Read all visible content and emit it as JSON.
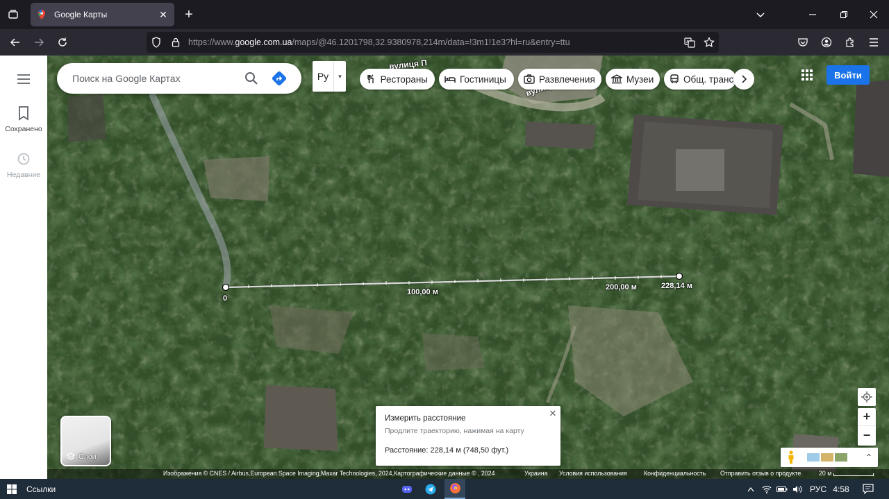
{
  "browser": {
    "tab_title": "Google Карты",
    "url_prefix": "https://www.",
    "url_domain": "google.com.ua",
    "url_rest": "/maps/@46.1201798,32.9380978,214m/data=!3m1!1e3?hl=ru&entry=ttu"
  },
  "sidebar": {
    "saved_label": "Сохранено",
    "recent_label": "Недавние"
  },
  "search": {
    "placeholder": "Поиск на Google Картах"
  },
  "language": {
    "label": "Ру"
  },
  "chips": [
    {
      "label": "Рестораны",
      "icon": "fork-knife-icon"
    },
    {
      "label": "Гостиницы",
      "icon": "bed-icon"
    },
    {
      "label": "Развлечения",
      "icon": "camera-icon"
    },
    {
      "label": "Музеи",
      "icon": "museum-icon"
    },
    {
      "label": "Общ. транспорт",
      "icon": "bus-icon"
    }
  ],
  "street_labels": [
    "вулиця П",
    "вулиця Па"
  ],
  "account": {
    "login_label": "Войти"
  },
  "measurement": {
    "start_label": "0",
    "mid_label": "100,00 м",
    "second_label": "200,00 м",
    "end_label": "228,14 м",
    "card_title": "Измерить расстояние",
    "card_hint": "Продлите траекторию, нажимая на карту",
    "card_distance": "Расстояние: 228,14 м (748,50 фут.)"
  },
  "layers": {
    "label": "Слои"
  },
  "attribution": {
    "imagery": "Изображения © CNES / Airbus,European Space Imaging,Maxar Technologies, 2024,Картографические данные © , 2024",
    "country": "Украина",
    "terms": "Условия использования",
    "privacy": "Конфиденциальность",
    "feedback": "Отправить отзыв о продукте",
    "scale": "20 м"
  },
  "taskbar": {
    "links_label": "Ссылки",
    "language": "РУС",
    "time": "4:58"
  },
  "colors": {
    "accent": "#1a73e8",
    "chrome_dark": "#1c1b22",
    "taskbar": "#1f2c3a"
  }
}
